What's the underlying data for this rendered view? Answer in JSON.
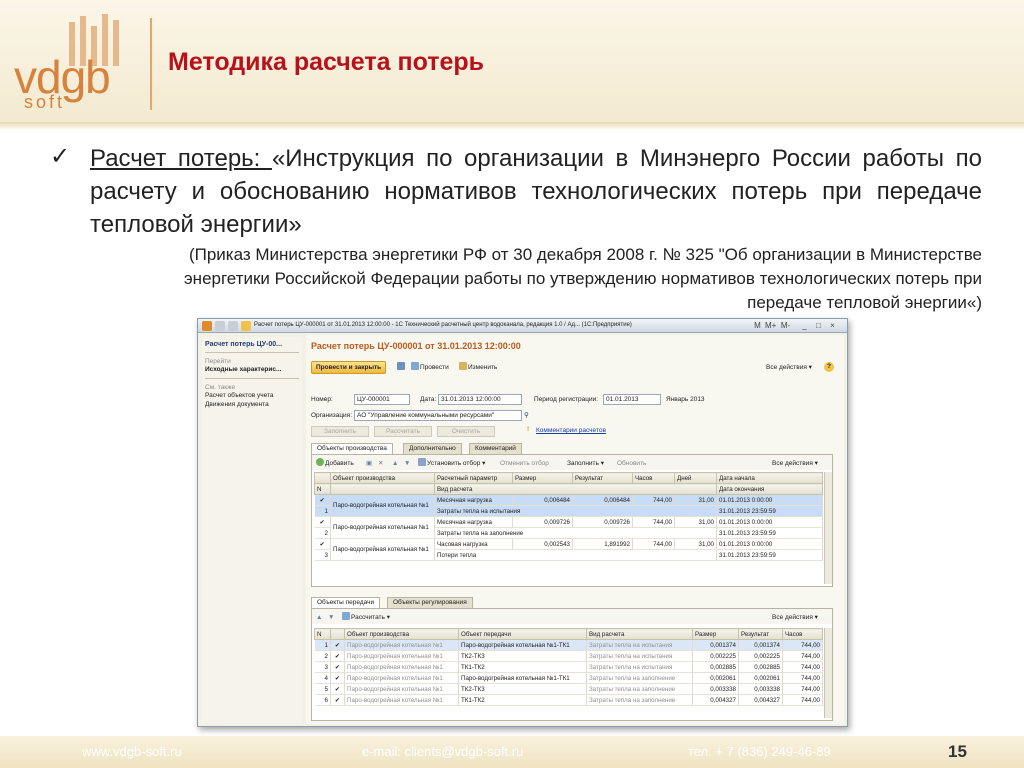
{
  "slide": {
    "logo": {
      "main": "vdgb",
      "sub": "soft"
    },
    "title": "Методика расчета потерь",
    "check_glyph": "✓",
    "lead_underlined": "Расчет потерь: ",
    "lead_text": "«Инструкция по организации в Минэнерго России работы по расчету и обоснованию нормативов технологических потерь при передаче тепловой энергии»",
    "reference": "(Приказ Министерства энергетики РФ от 30 декабря 2008 г. № 325 \"Об организации в Министерстве энергетики Российской Федерации работы по утверждению нормативов технологических потерь при передаче тепловой энергии«)",
    "footer": {
      "site": "www.vdgb-soft.ru",
      "email": "e-mail: clients@vdgb-soft.ru",
      "phone": "тел. + 7 (836) 249-46-89",
      "page": "15"
    }
  },
  "window": {
    "title": "Расчет потерь ЦУ-000001 от 31.01.2013 12:00:00 - 1С Технический расчетный центр водоканала, редакция 1.0 / Ад... (1С:Предприятие)",
    "controls": {
      "m": "M",
      "mplus": "M+",
      "mminus": "M-",
      "min": "_",
      "max": "□",
      "close": "×"
    },
    "left_panel": {
      "header": "Расчет потерь ЦУ-00...",
      "goto_caption": "Перейти",
      "goto_item": "Исходные характерис...",
      "see_also_caption": "См. также",
      "see_also_items": [
        "Расчет объектов учета",
        "Движения документа"
      ]
    },
    "form": {
      "title": "Расчет потерь ЦУ-000001 от 31.01.2013 12:00:00",
      "toolbar": {
        "post_close": "Провести и закрыть",
        "post": "Провести",
        "change": "Изменить",
        "all_actions": "Все действия ▾",
        "help": "?"
      },
      "number_label": "Номер:",
      "number_value": "ЦУ-000001",
      "date_label": "Дата:",
      "date_value": "31.01.2013 12:00:00",
      "period_label": "Период регистрации:",
      "period_value": "01.01.2013",
      "period_text": "Январь 2013",
      "org_label": "Организация:",
      "org_value": "АО \"Управление коммунальными ресурсами\"",
      "btn_fill": "Заполнить",
      "btn_calc": "Рассчитать",
      "btn_clear": "Очистить",
      "comments_link": "Комментарии расчетов",
      "tabs": [
        "Объекты производства",
        "Дополнительно",
        "Комментарий"
      ],
      "prod_toolbar": {
        "add": "Добавить",
        "set_filter": "Установить отбор ▾",
        "cancel_filter": "Отменить отбор",
        "fill": "Заполнить ▾",
        "refresh": "Обновить",
        "all_actions": "Все действия ▾"
      },
      "prod_headers": [
        "N",
        "Объект производства",
        "Расчетный параметр",
        "Размер",
        "Результат",
        "Часов",
        "Дней",
        "Дата начала"
      ],
      "prod_headers2": [
        "Вид расчета",
        "Дата окончания"
      ],
      "prod_rows": [
        {
          "check": "✔",
          "n": "1",
          "object": "Паро-водогрейная котельная №1",
          "param": "Месячная нагрузка",
          "kind": "Затраты тепла на испытания",
          "size": "0,006484",
          "result": "0,006484",
          "hours": "744,00",
          "days": "31,00",
          "start": "01.01.2013 0:00:00",
          "end": "31.01.2013 23:59:59"
        },
        {
          "check": "✔",
          "n": "2",
          "object": "Паро-водогрейная котельная №1",
          "param": "Месячная нагрузка",
          "kind": "Затраты тепла на заполнение",
          "size": "0,009726",
          "result": "0,009726",
          "hours": "744,00",
          "days": "31,00",
          "start": "01.01.2013 0:00:00",
          "end": "31.01.2013 23:59:59"
        },
        {
          "check": "✔",
          "n": "3",
          "object": "Паро-водогрейная котельная №1",
          "param": "Часовая нагрузка",
          "kind": "Потери тепла",
          "size": "0,002543",
          "result": "1,891992",
          "hours": "744,00",
          "days": "31,00",
          "start": "01.01.2013 0:00:00",
          "end": "31.01.2013 23:59:59"
        }
      ],
      "tabs2": [
        "Объекты передачи",
        "Объекты регулирования"
      ],
      "trans_toolbar": {
        "calculate": "Рассчитать ▾",
        "all_actions": "Все действия ▾"
      },
      "trans_headers": [
        "N",
        "",
        "Объект производства",
        "Объект передачи",
        "Вид расчета",
        "Размер",
        "Результат",
        "Часов"
      ],
      "trans_rows": [
        {
          "n": "1",
          "check": "✔",
          "prod": "Паро-водогрейная котельная №1",
          "trans": "Паро-водогрейная котельная №1-ТК1",
          "kind": "Затраты тепла на испытания",
          "size": "0,001374",
          "result": "0,001374",
          "hours": "744,00"
        },
        {
          "n": "2",
          "check": "✔",
          "prod": "Паро-водогрейная котельная №1",
          "trans": "ТК2-ТК3",
          "kind": "Затраты тепла на испытания",
          "size": "0,002225",
          "result": "0,002225",
          "hours": "744,00"
        },
        {
          "n": "3",
          "check": "✔",
          "prod": "Паро-водогрейная котельная №1",
          "trans": "ТК1-ТК2",
          "kind": "Затраты тепла на испытания",
          "size": "0,002885",
          "result": "0,002885",
          "hours": "744,00"
        },
        {
          "n": "4",
          "check": "✔",
          "prod": "Паро-водогрейная котельная №1",
          "trans": "Паро-водогрейная котельная №1-ТК1",
          "kind": "Затраты тепла на заполнение",
          "size": "0,002061",
          "result": "0,002061",
          "hours": "744,00"
        },
        {
          "n": "5",
          "check": "✔",
          "prod": "Паро-водогрейная котельная №1",
          "trans": "ТК2-ТК3",
          "kind": "Затраты тепла на заполнение",
          "size": "0,003338",
          "result": "0,003338",
          "hours": "744,00"
        },
        {
          "n": "6",
          "check": "✔",
          "prod": "Паро-водогрейная котельная №1",
          "trans": "ТК1-ТК2",
          "kind": "Затраты тепла на заполнение",
          "size": "0,004327",
          "result": "0,004327",
          "hours": "744,00"
        }
      ]
    }
  }
}
